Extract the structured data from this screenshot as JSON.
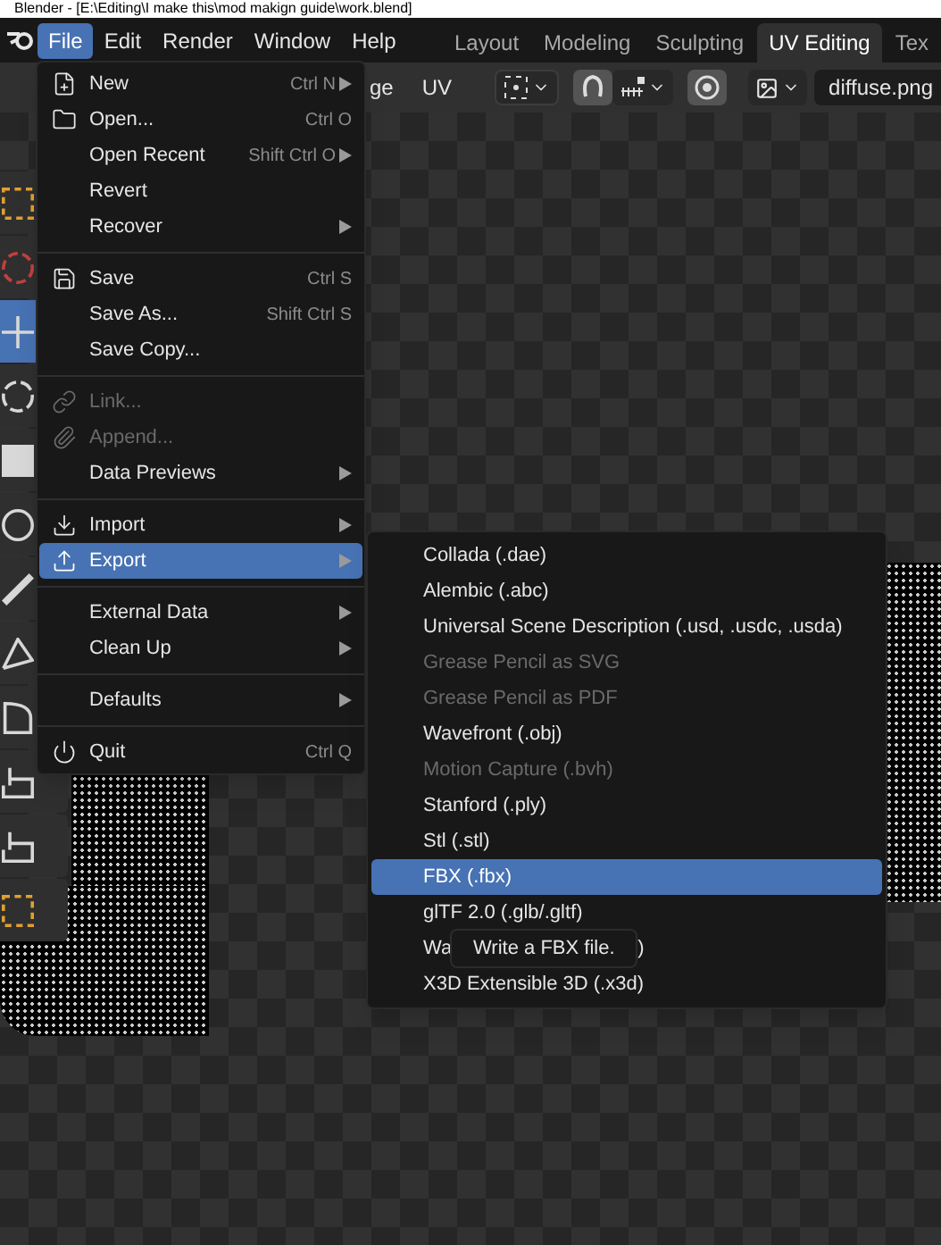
{
  "window": {
    "title": "Blender - [E:\\Editing\\I make this\\mod makign guide\\work.blend]"
  },
  "menubar": [
    {
      "label": "File",
      "selected": true
    },
    {
      "label": "Edit",
      "selected": false
    },
    {
      "label": "Render",
      "selected": false
    },
    {
      "label": "Window",
      "selected": false
    },
    {
      "label": "Help",
      "selected": false
    }
  ],
  "workspace_tabs": [
    {
      "label": "Layout",
      "selected": false
    },
    {
      "label": "Modeling",
      "selected": false
    },
    {
      "label": "Sculpting",
      "selected": false
    },
    {
      "label": "UV Editing",
      "selected": true
    },
    {
      "label": "Tex",
      "selected": false
    }
  ],
  "header": {
    "view_label": "ge",
    "uv_menu": "UV",
    "image_name": "diffuse.png"
  },
  "toolbar": [
    {
      "selected": false
    },
    {
      "selected": false
    },
    {
      "selected": true
    },
    {
      "selected": false
    },
    {
      "selected": false
    },
    {
      "selected": false
    },
    {
      "selected": false
    },
    {
      "selected": false
    },
    {
      "selected": false
    },
    {
      "selected": false
    },
    {
      "selected": false
    },
    {
      "selected": false
    }
  ],
  "file_menu": [
    [
      {
        "label": "New",
        "shortcut": "Ctrl N",
        "submenu": true,
        "disabled": false,
        "selected": false
      },
      {
        "label": "Open...",
        "shortcut": "Ctrl O",
        "submenu": false,
        "disabled": false,
        "selected": false
      },
      {
        "label": "Open Recent",
        "shortcut": "Shift Ctrl O",
        "submenu": true,
        "disabled": false,
        "selected": false
      },
      {
        "label": "Revert",
        "submenu": false,
        "disabled": false,
        "selected": false
      },
      {
        "label": "Recover",
        "submenu": true,
        "disabled": false,
        "selected": false
      }
    ],
    [
      {
        "label": "Save",
        "shortcut": "Ctrl S",
        "submenu": false,
        "disabled": false,
        "selected": false
      },
      {
        "label": "Save As...",
        "shortcut": "Shift Ctrl S",
        "submenu": false,
        "disabled": false,
        "selected": false
      },
      {
        "label": "Save Copy...",
        "submenu": false,
        "disabled": false,
        "selected": false
      }
    ],
    [
      {
        "label": "Link...",
        "submenu": false,
        "disabled": true,
        "selected": false
      },
      {
        "label": "Append...",
        "submenu": false,
        "disabled": true,
        "selected": false
      },
      {
        "label": "Data Previews",
        "submenu": true,
        "disabled": false,
        "selected": false
      }
    ],
    [
      {
        "label": "Import",
        "submenu": true,
        "disabled": false,
        "selected": false
      },
      {
        "label": "Export",
        "submenu": true,
        "disabled": false,
        "selected": true
      }
    ],
    [
      {
        "label": "External Data",
        "submenu": true,
        "disabled": false,
        "selected": false
      },
      {
        "label": "Clean Up",
        "submenu": true,
        "disabled": false,
        "selected": false
      }
    ],
    [
      {
        "label": "Defaults",
        "submenu": true,
        "disabled": false,
        "selected": false
      }
    ],
    [
      {
        "label": "Quit",
        "shortcut": "Ctrl Q",
        "submenu": false,
        "disabled": false,
        "selected": false
      }
    ]
  ],
  "export_menu": [
    {
      "label": "Collada (.dae)",
      "disabled": false,
      "selected": false
    },
    {
      "label": "Alembic (.abc)",
      "disabled": false,
      "selected": false
    },
    {
      "label": "Universal Scene Description (.usd, .usdc, .usda)",
      "disabled": false,
      "selected": false
    },
    {
      "label": "Grease Pencil as SVG",
      "disabled": true,
      "selected": false
    },
    {
      "label": "Grease Pencil as PDF",
      "disabled": true,
      "selected": false
    },
    {
      "label": "Wavefront (.obj)",
      "disabled": false,
      "selected": false
    },
    {
      "label": "Motion Capture (.bvh)",
      "disabled": true,
      "selected": false
    },
    {
      "label": "Stanford (.ply)",
      "disabled": false,
      "selected": false
    },
    {
      "label": "Stl (.stl)",
      "disabled": false,
      "selected": false
    },
    {
      "label": "FBX (.fbx)",
      "disabled": false,
      "selected": true
    },
    {
      "label": "glTF 2.0 (.glb/.gltf)",
      "disabled": false,
      "selected": false
    },
    {
      "label": "Wa",
      "label_end": ")",
      "disabled": false,
      "selected": false
    },
    {
      "label": "X3D Extensible 3D (.x3d)",
      "disabled": false,
      "selected": false
    }
  ],
  "tooltip": "Write a FBX file."
}
